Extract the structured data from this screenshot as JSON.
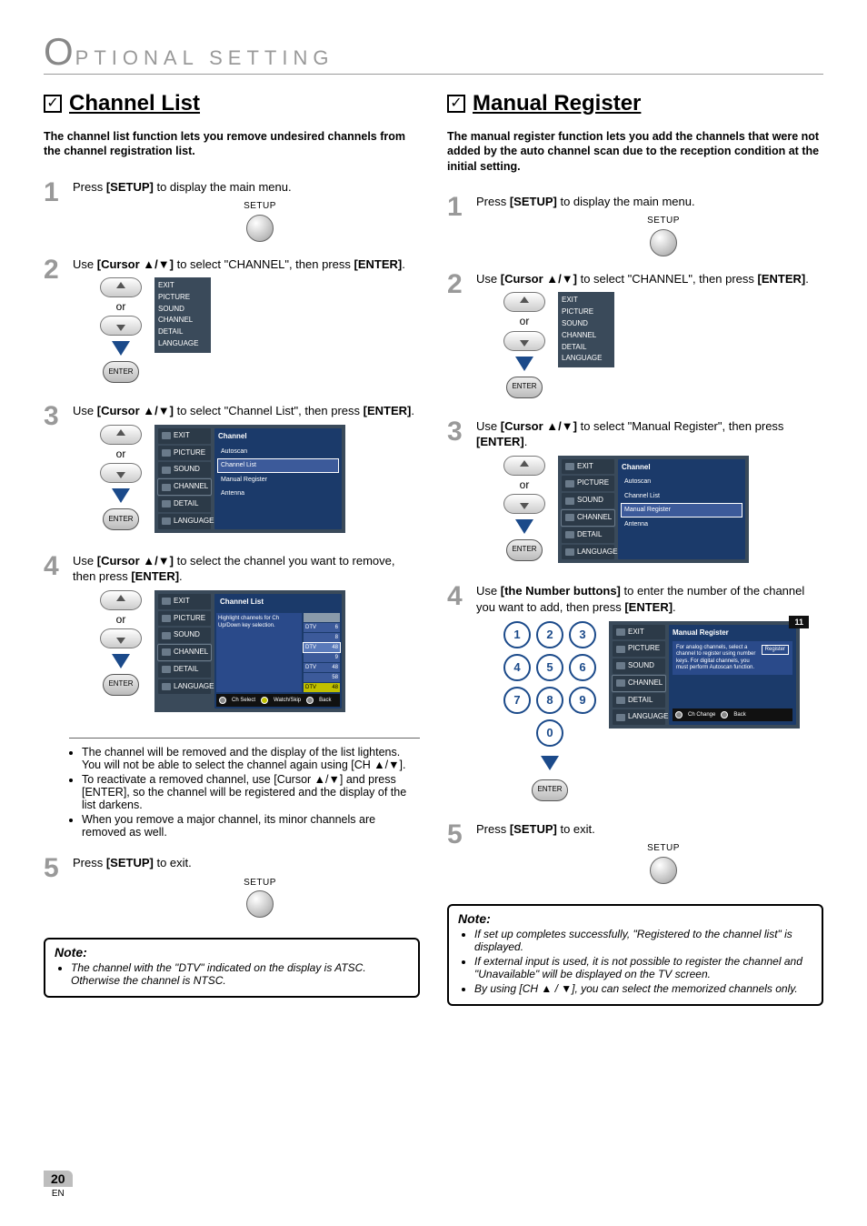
{
  "header": {
    "big": "O",
    "rest": "PTIONAL  SETTING"
  },
  "page_number": "20",
  "page_lang": "EN",
  "channel_list": {
    "title": "Channel List",
    "intro": "The channel list function lets you remove undesired channels from the channel registration list.",
    "steps": [
      {
        "n": "1",
        "text_pre": "Press ",
        "key": "[SETUP]",
        "text_post": " to display the main menu.",
        "setup_label": "SETUP"
      },
      {
        "n": "2",
        "text_pre": "Use ",
        "key": "[Cursor ▲/▼]",
        "text_mid": " to select \"CHANNEL\", then press ",
        "key2": "[ENTER]",
        "text_post": ".",
        "or": "or",
        "enter": "ENTER",
        "osd_side": [
          "EXIT",
          "PICTURE",
          "SOUND",
          "CHANNEL",
          "DETAIL",
          "LANGUAGE"
        ]
      },
      {
        "n": "3",
        "text_pre": "Use ",
        "key": "[Cursor ▲/▼]",
        "text_mid": " to select \"Channel List\", then press ",
        "key2": "[ENTER]",
        "text_post": ".",
        "or": "or",
        "enter": "ENTER",
        "osd_side": [
          "EXIT",
          "PICTURE",
          "SOUND",
          "CHANNEL",
          "DETAIL",
          "LANGUAGE"
        ],
        "osd_main_title": "Channel",
        "osd_main_items": [
          "Autoscan",
          "Channel List",
          "Manual Register",
          "Antenna"
        ],
        "osd_main_sel": "Channel List"
      },
      {
        "n": "4",
        "text_pre": "Use ",
        "key": "[Cursor ▲/▼]",
        "text_mid": " to select the channel you want to remove, then press ",
        "key2": "[ENTER]",
        "text_post": ".",
        "or": "or",
        "enter": "ENTER",
        "osd_side": [
          "EXIT",
          "PICTURE",
          "SOUND",
          "CHANNEL",
          "DETAIL",
          "LANGUAGE"
        ],
        "osd_main_title": "Channel List",
        "osd_hint": "Highlight channels for Ch Up/Down key selection.",
        "chrows": [
          {
            "l": "DTV",
            "r": "6"
          },
          {
            "l": "",
            "r": "8"
          },
          {
            "l": "DTV",
            "r": "48"
          },
          {
            "l": "",
            "r": "9"
          },
          {
            "l": "DTV",
            "r": "48"
          },
          {
            "l": "",
            "r": "58"
          },
          {
            "l": "DTV",
            "r": "48"
          }
        ],
        "foot": [
          "Ch Select",
          "Watch/Skip",
          "Back"
        ]
      },
      {
        "n": "5",
        "text_pre": "Press ",
        "key": "[SETUP]",
        "text_post": " to exit.",
        "setup_label": "SETUP"
      }
    ],
    "bullets": [
      "The channel will be removed and the display of the list lightens. You will not be able to select the channel again using [CH ▲/▼].",
      "To reactivate a removed channel, use [Cursor ▲/▼] and press [ENTER], so the channel will be registered and the display of the list darkens.",
      "When you remove a major channel, its minor channels are removed as well."
    ],
    "note_label": "Note:",
    "note_items": [
      "The channel with the \"DTV\" indicated on the display is ATSC. Otherwise the channel is NTSC."
    ]
  },
  "manual_register": {
    "title": "Manual Register",
    "intro": "The manual register function lets you add the channels that were not added by the auto channel scan due to the reception condition at the initial setting.",
    "steps": [
      {
        "n": "1",
        "text_pre": "Press ",
        "key": "[SETUP]",
        "text_post": " to display the main menu.",
        "setup_label": "SETUP"
      },
      {
        "n": "2",
        "text_pre": "Use ",
        "key": "[Cursor ▲/▼]",
        "text_mid": " to select \"CHANNEL\", then press ",
        "key2": "[ENTER]",
        "text_post": ".",
        "or": "or",
        "enter": "ENTER",
        "osd_side": [
          "EXIT",
          "PICTURE",
          "SOUND",
          "CHANNEL",
          "DETAIL",
          "LANGUAGE"
        ]
      },
      {
        "n": "3",
        "text_pre": "Use ",
        "key": "[Cursor ▲/▼]",
        "text_mid": " to select \"Manual Register\", then press ",
        "key2": "[ENTER]",
        "text_post": ".",
        "or": "or",
        "enter": "ENTER",
        "osd_side": [
          "EXIT",
          "PICTURE",
          "SOUND",
          "CHANNEL",
          "DETAIL",
          "LANGUAGE"
        ],
        "osd_main_title": "Channel",
        "osd_main_items": [
          "Autoscan",
          "Channel List",
          "Manual Register",
          "Antenna"
        ],
        "osd_main_sel": "Manual Register"
      },
      {
        "n": "4",
        "text_pre": "Use ",
        "key": "[the Number buttons]",
        "text_mid": " to enter the number of the channel you want to add, then press ",
        "key2": "[ENTER]",
        "text_post": ".",
        "numpad": [
          "1",
          "2",
          "3",
          "4",
          "5",
          "6",
          "7",
          "8",
          "9",
          "0"
        ],
        "enter": "ENTER",
        "osd_side": [
          "EXIT",
          "PICTURE",
          "SOUND",
          "CHANNEL",
          "DETAIL",
          "LANGUAGE"
        ],
        "osd_main_title": "Manual Register",
        "osd_content": "For analog channels, select a channel to register using number keys.\nFor digital channels, you must perform Autoscan function.",
        "reg_btn": "Register",
        "badge": "11",
        "foot": [
          "Ch Change",
          "Back"
        ]
      },
      {
        "n": "5",
        "text_pre": "Press ",
        "key": "[SETUP]",
        "text_post": " to exit.",
        "setup_label": "SETUP"
      }
    ],
    "note_label": "Note:",
    "note_items": [
      "If set up completes successfully, \"Registered to the channel list\" is displayed.",
      "If external input is used, it is not possible to register the channel and \"Unavailable\" will be displayed on the TV screen.",
      "By using [CH ▲ / ▼], you can select the memorized channels only."
    ]
  }
}
